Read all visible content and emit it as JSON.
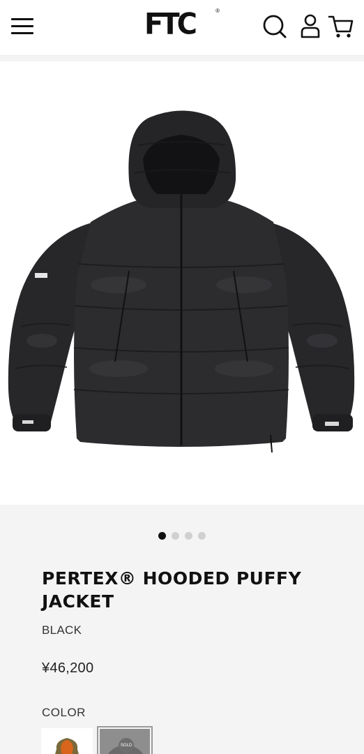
{
  "header": {
    "logo_text": "FTC",
    "logo_mark": "®",
    "icons": [
      "menu-icon",
      "search-icon",
      "account-icon",
      "cart-icon"
    ]
  },
  "gallery": {
    "slide_count": 4,
    "active_index": 0
  },
  "product": {
    "title": "PERTEX® HOODED PUFFY JACKET",
    "color_name": "BLACK",
    "price": "¥46,200",
    "color_label": "COLOR",
    "swatches": [
      {
        "name": "orange/olive",
        "selected": false
      },
      {
        "name": "black",
        "selected": true,
        "badge": "SOLD"
      }
    ]
  },
  "colors": {
    "header_bg": "#ffffff",
    "page_bg": "#f4f4f4",
    "text": "#111111",
    "jacket": "#2a2a2c"
  }
}
